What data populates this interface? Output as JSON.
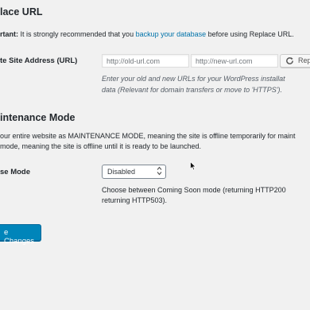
{
  "replace_url": {
    "title": "lace URL",
    "notice_prefix": "rtant:",
    "notice_text": " It is strongly recommended that you ",
    "notice_link": "backup your database",
    "notice_suffix": " before using Replace URL.",
    "field_label": "te Site Address (URL)",
    "old_url_placeholder": "http://old-url.com",
    "new_url_placeholder": "http://new-url.com",
    "replace_button": "Rep",
    "description_line1": "Enter your old and new URLs for your WordPress installat",
    "description_line2": "data (Relevant for domain transfers or move to 'HTTPS')."
  },
  "maintenance": {
    "title": "intenance Mode",
    "intro_line1": "our entire website as MAINTENANCE MODE, meaning the site is offline temporarily for maint",
    "intro_line2": "mode, meaning the site is offline until it is ready to be launched.",
    "field_label": "se Mode",
    "selected_option": "Disabled",
    "help_line1": "Choose between Coming Soon mode (returning HTTP200",
    "help_line2": "returning HTTP503)."
  },
  "save_button": "e Changes",
  "icons": {
    "replace": "refresh-icon",
    "select_arrow": "chevron-updown-icon",
    "cursor": "mouse-pointer-icon"
  }
}
